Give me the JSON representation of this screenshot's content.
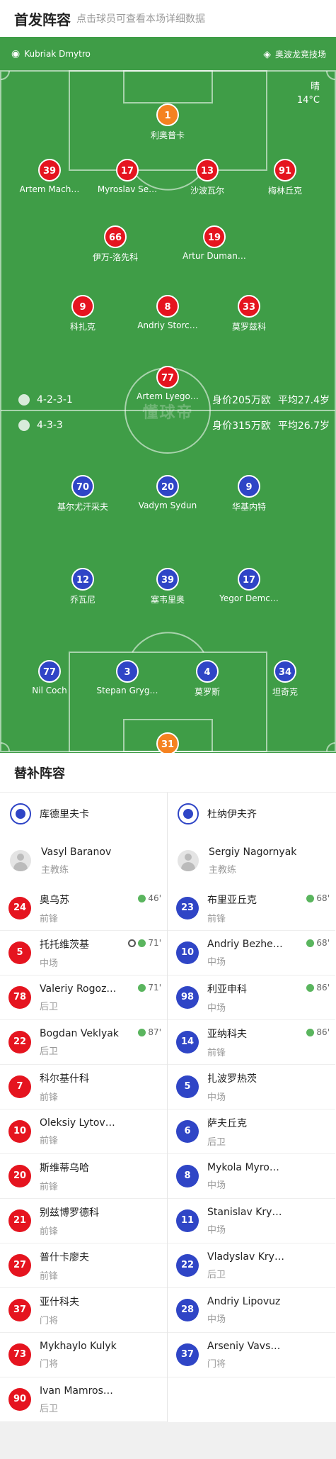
{
  "header": {
    "title": "首发阵容",
    "subtitle": "点击球员可查看本场详细数据"
  },
  "match": {
    "referee": "Kubriak Dmytro",
    "stadium": "奥波龙竞技场",
    "weather": "晴",
    "temp": "14°C",
    "watermark": "懂球帝"
  },
  "home_form": {
    "formation": "4-2-3-1",
    "value": "身价205万欧",
    "age": "平均27.4岁"
  },
  "away_form": {
    "formation": "4-3-3",
    "value": "身价315万欧",
    "age": "平均26.7岁"
  },
  "home_players": [
    {
      "no": "1",
      "name": "利奥普卡",
      "gk": true
    },
    {
      "no": "39",
      "name": "Artem Mach…"
    },
    {
      "no": "17",
      "name": "Myroslav Se…"
    },
    {
      "no": "13",
      "name": "沙波瓦尔"
    },
    {
      "no": "91",
      "name": "梅林丘克",
      "card": "yellow"
    },
    {
      "no": "66",
      "name": "伊万-洛先科",
      "sub": "87'"
    },
    {
      "no": "19",
      "name": "Artur Duman…"
    },
    {
      "no": "9",
      "name": "科扎克",
      "sub": "80'"
    },
    {
      "no": "8",
      "name": "Andriy Storc…",
      "sub": "71'"
    },
    {
      "no": "33",
      "name": "莫罗兹科",
      "sub": "71'"
    },
    {
      "no": "77",
      "name": "Artem Lyego…",
      "sub": "46'"
    }
  ],
  "away_players": [
    {
      "no": "70",
      "name": "基尔尤汗采夫",
      "sub": "86'"
    },
    {
      "no": "20",
      "name": "Vadym Sydun",
      "sub": "68'"
    },
    {
      "no": "9",
      "name": "华基内特"
    },
    {
      "no": "12",
      "name": "乔瓦尼",
      "sub": "61'"
    },
    {
      "no": "39",
      "name": "塞韦里奥",
      "sub": "86'",
      "goal": true
    },
    {
      "no": "17",
      "name": "Yegor Demc…",
      "sub": "68'"
    },
    {
      "no": "77",
      "name": "Nil Coch"
    },
    {
      "no": "3",
      "name": "Stepan Gryg…",
      "card": "yellow"
    },
    {
      "no": "4",
      "name": "莫罗斯",
      "goal": true
    },
    {
      "no": "34",
      "name": "坦奇克"
    },
    {
      "no": "31",
      "name": "比雷克",
      "gk": true
    }
  ],
  "subs": {
    "title": "替补阵容",
    "home": {
      "team": "库德里夫卡",
      "coach": {
        "name": "Vasyl Baranov",
        "role": "主教练"
      },
      "players": [
        {
          "no": "24",
          "name": "奥乌苏",
          "pos": "前锋",
          "ev": "46'"
        },
        {
          "no": "5",
          "name": "托托维茨基",
          "pos": "中场",
          "ev": "71'",
          "goal": true
        },
        {
          "no": "78",
          "name": "Valeriy Rogoz…",
          "pos": "后卫",
          "ev": "71'"
        },
        {
          "no": "22",
          "name": "Bogdan Veklyak",
          "pos": "后卫",
          "ev": "87'"
        },
        {
          "no": "7",
          "name": "科尔基什科",
          "pos": "前锋"
        },
        {
          "no": "10",
          "name": "Oleksiy Lytov…",
          "pos": "前锋"
        },
        {
          "no": "20",
          "name": "斯维蒂乌哈",
          "pos": "前锋"
        },
        {
          "no": "21",
          "name": "别兹博罗德科",
          "pos": "前锋"
        },
        {
          "no": "27",
          "name": "普什卡廖夫",
          "pos": "前锋"
        },
        {
          "no": "37",
          "name": "亚什科夫",
          "pos": "门将"
        },
        {
          "no": "73",
          "name": "Mykhaylo Kulyk",
          "pos": "门将"
        },
        {
          "no": "90",
          "name": "Ivan Mamros…",
          "pos": "后卫"
        }
      ]
    },
    "away": {
      "team": "杜纳伊夫齐",
      "coach": {
        "name": "Sergiy Nagornyak",
        "role": "主教练"
      },
      "players": [
        {
          "no": "23",
          "name": "布里亚丘克",
          "pos": "前锋",
          "ev": "68'"
        },
        {
          "no": "10",
          "name": "Andriy Bezhe…",
          "pos": "中场",
          "ev": "68'"
        },
        {
          "no": "98",
          "name": "利亚申科",
          "pos": "中场",
          "ev": "86'"
        },
        {
          "no": "14",
          "name": "亚纳科夫",
          "pos": "前锋",
          "ev": "86'"
        },
        {
          "no": "5",
          "name": "扎波罗热茨",
          "pos": "中场"
        },
        {
          "no": "6",
          "name": "萨夫丘克",
          "pos": "后卫"
        },
        {
          "no": "8",
          "name": "Mykola Myro…",
          "pos": "中场"
        },
        {
          "no": "11",
          "name": "Stanislav Kry…",
          "pos": "中场"
        },
        {
          "no": "22",
          "name": "Vladyslav Kry…",
          "pos": "后卫"
        },
        {
          "no": "28",
          "name": "Andriy Lipovuz",
          "pos": "中场"
        },
        {
          "no": "37",
          "name": "Arseniy Vavs…",
          "pos": "门将"
        }
      ]
    }
  },
  "colors": {
    "home": "#e5141f",
    "away": "#2f45c6",
    "gk": "#f58220",
    "pitch": "#3f9d47"
  }
}
